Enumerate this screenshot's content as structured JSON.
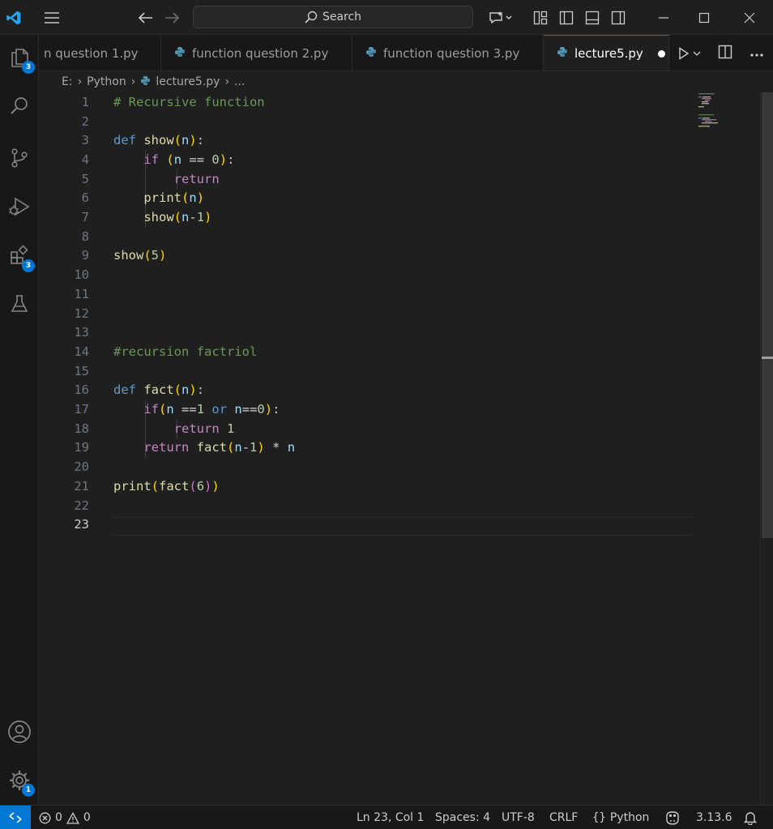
{
  "titlebar": {
    "search_placeholder": "Search"
  },
  "activity_bar": {
    "explorer_badge": "3",
    "extensions_badge": "3",
    "settings_badge": "1"
  },
  "tabs": [
    {
      "label": "n question 1.py",
      "active": false
    },
    {
      "label": "function question 2.py",
      "active": false
    },
    {
      "label": "function question 3.py",
      "active": false
    },
    {
      "label": "lecture5.py",
      "active": true,
      "modified": true
    }
  ],
  "breadcrumb": {
    "drive": "E:",
    "folder": "Python",
    "file": "lecture5.py",
    "more": "..."
  },
  "editor": {
    "current_line": 23,
    "line_numbers": [
      "1",
      "2",
      "3",
      "4",
      "5",
      "6",
      "7",
      "8",
      "9",
      "10",
      "11",
      "12",
      "13",
      "14",
      "15",
      "16",
      "17",
      "18",
      "19",
      "20",
      "21",
      "22",
      "23"
    ]
  },
  "statusbar": {
    "errors": "0",
    "warnings": "0",
    "position": "Ln 23, Col 1",
    "spaces": "Spaces: 4",
    "encoding": "UTF-8",
    "eol": "CRLF",
    "language": "Python",
    "interpreter_version": "3.13.6"
  },
  "colors": {
    "accent": "#0078d4",
    "comment": "#6a9955",
    "keyword": "#569cd6",
    "control": "#c586c0",
    "function": "#dcdcaa",
    "variable": "#9cdcfe",
    "number": "#b5cea8"
  }
}
